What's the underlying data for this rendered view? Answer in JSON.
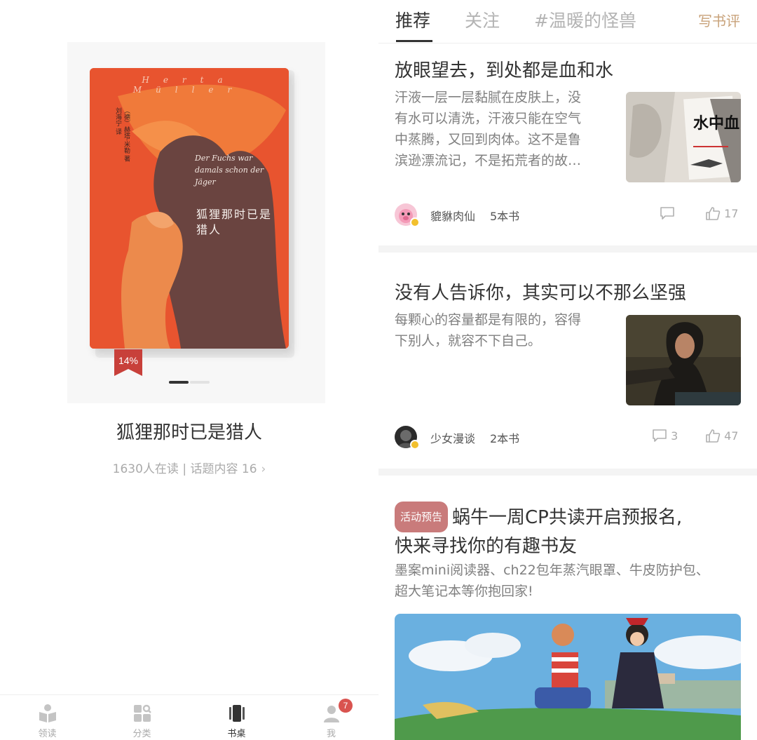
{
  "left": {
    "cover": {
      "author_latin": "Herta Müller",
      "credit": "（德）赫塔·米勒 著  刘海宁 译",
      "title_de": "Der Fuchs war damals schon der Jäger",
      "title_cn": "狐狸那时已是猎人",
      "cover_color": "#e8542f",
      "progress_label": "14%",
      "progress_value": 0.14
    },
    "pager": {
      "active_index": 0,
      "count": 2
    },
    "book_title": "狐狸那时已是猎人",
    "book_meta": "1630人在读 | 话题内容 16",
    "book_meta_chevron": "›"
  },
  "tabbar": {
    "tabs": [
      {
        "label": "领读",
        "icon": "book-open-icon"
      },
      {
        "label": "分类",
        "icon": "grid-search-icon"
      },
      {
        "label": "书桌",
        "icon": "phone-desk-icon"
      },
      {
        "label": "我",
        "icon": "user-icon",
        "badge": "7"
      }
    ],
    "active_index": 2
  },
  "right": {
    "nav": {
      "tabs": [
        "推荐",
        "关注",
        "#温暖的怪兽"
      ],
      "active_index": 0,
      "action": "写书评",
      "accent": "#c8a27a"
    },
    "cards": [
      {
        "title": "放眼望去，到处都是血和水",
        "excerpt_lines": [
          "汗液一层一层黏腻在皮肤上，没",
          "有水可以清洗，汗液只能在空气",
          "中蒸腾，又回到肉体。这不是鲁",
          "滨逊漂流记，不是拓荒者的故…"
        ],
        "thumb_text": "水中血",
        "author": "貔貅肉仙",
        "books": "5本书",
        "comments": "",
        "likes": "17"
      },
      {
        "title": "没有人告诉你，其实可以不那么坚强",
        "excerpt_lines": [
          "每颗心的容量都是有限的，容得",
          "下别人，就容不下自己。"
        ],
        "author": "少女漫谈",
        "books": "2本书",
        "comments": "3",
        "likes": "47"
      }
    ],
    "event": {
      "tag": "活动预告",
      "title_line1": "蜗牛一周CP共读开启预报名,",
      "title_line2": "快来寻找你的有趣书友",
      "desc_line1": "墨案mini阅读器、ch22包年蒸汽眼罩、牛皮防护包、",
      "desc_line2": "超大笔记本等你抱回家!"
    }
  }
}
